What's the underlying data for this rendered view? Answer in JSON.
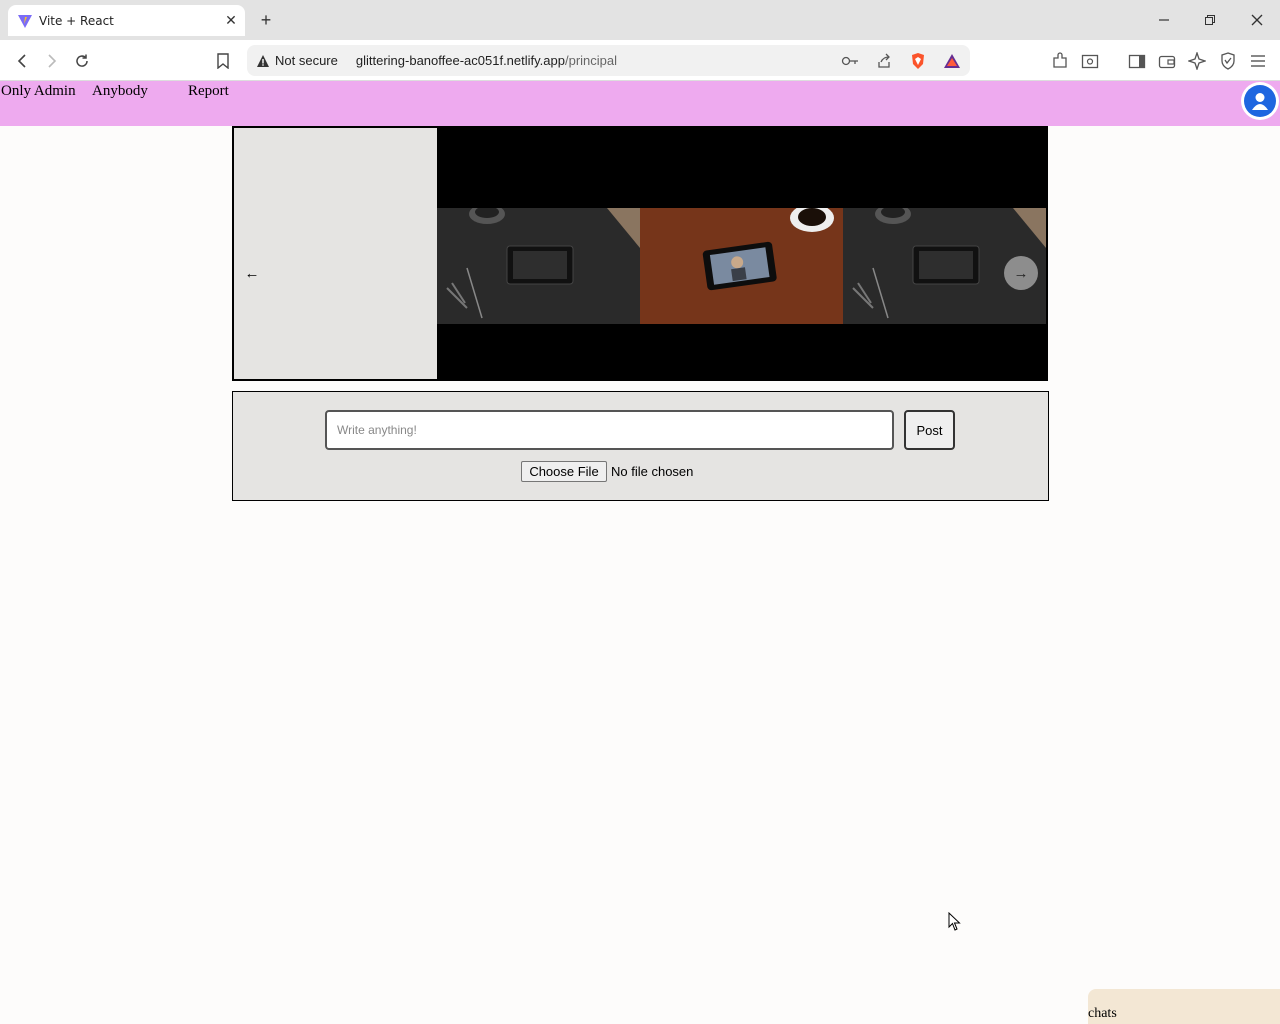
{
  "browser": {
    "tab_title": "Vite + React",
    "security_label": "Not secure",
    "url_host": "glittering-banoffee-ac051f.netlify.app",
    "url_path": "/principal"
  },
  "nav": {
    "links": [
      {
        "label": "Only Admin"
      },
      {
        "label": "Anybody"
      },
      {
        "label": "Report"
      }
    ]
  },
  "carousel": {
    "prev_arrow": "←",
    "next_arrow": "→"
  },
  "composer": {
    "placeholder": "Write anything!",
    "post_label": "Post",
    "file_button_label": "Choose File",
    "file_status": "No file chosen"
  },
  "chats": {
    "label": "chats"
  },
  "colors": {
    "navbar": "#eeaaef",
    "avatar": "#1e66e0",
    "chats_panel": "#f3e7d4",
    "composer_bg": "#e5e4e2"
  }
}
